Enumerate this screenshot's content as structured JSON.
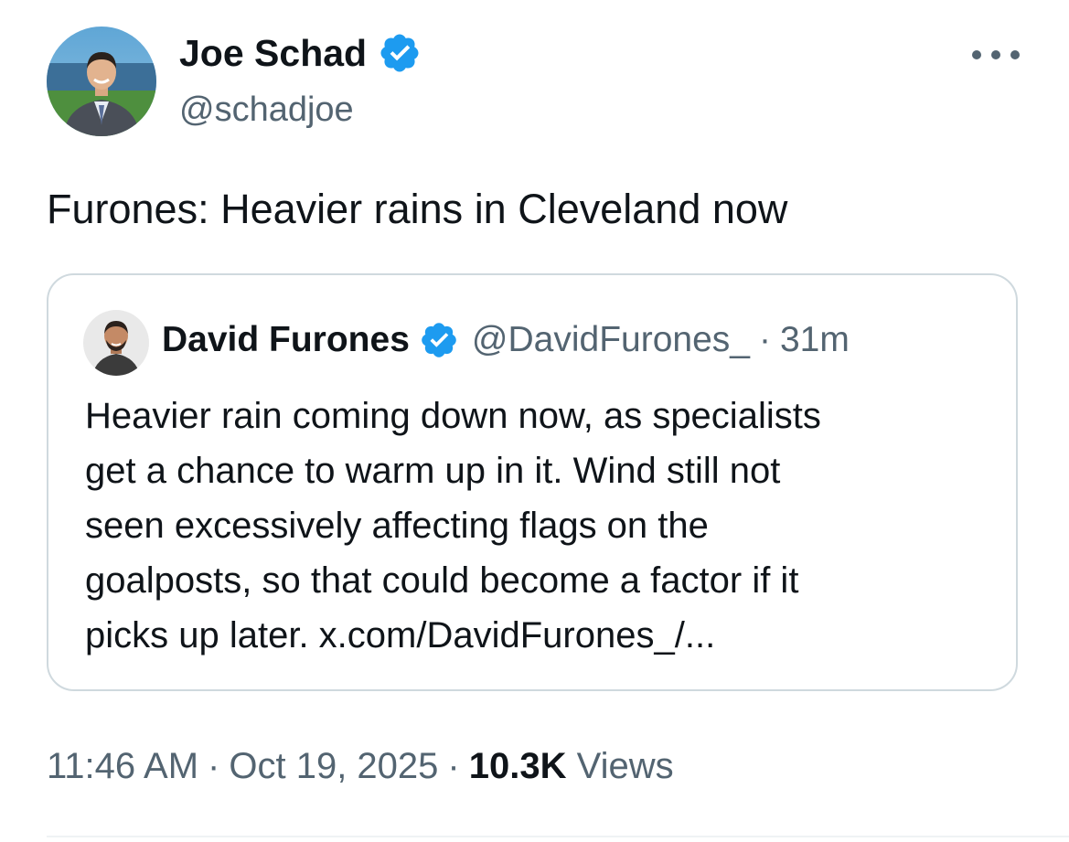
{
  "author": {
    "name": "Joe Schad",
    "handle": "@schadjoe",
    "verified_icon": "verified-badge-icon",
    "verified_color": "#1d9bf0"
  },
  "more_icon": "more-horizontal-icon",
  "tweet": {
    "text": "Furones: Heavier rains in Cleveland now"
  },
  "quote": {
    "name": "David Furones",
    "handle": "@DavidFurones_",
    "separator": "·",
    "time": "31m",
    "lines": [
      "Heavier rain coming down now, as specialists",
      "get a chance to warm up in it. Wind still not",
      "seen excessively affecting flags on the",
      "goalposts, so that could become a factor if it",
      "picks up later. x.com/DavidFurones_/..."
    ]
  },
  "meta": {
    "time": "11:46 AM",
    "separator": "·",
    "date": "Oct 19, 2025",
    "views_count": "10.3K",
    "views_label": "Views"
  },
  "colors": {
    "text_primary": "#0f1419",
    "text_secondary": "#536471",
    "border": "#cfd9de",
    "accent": "#1d9bf0"
  }
}
